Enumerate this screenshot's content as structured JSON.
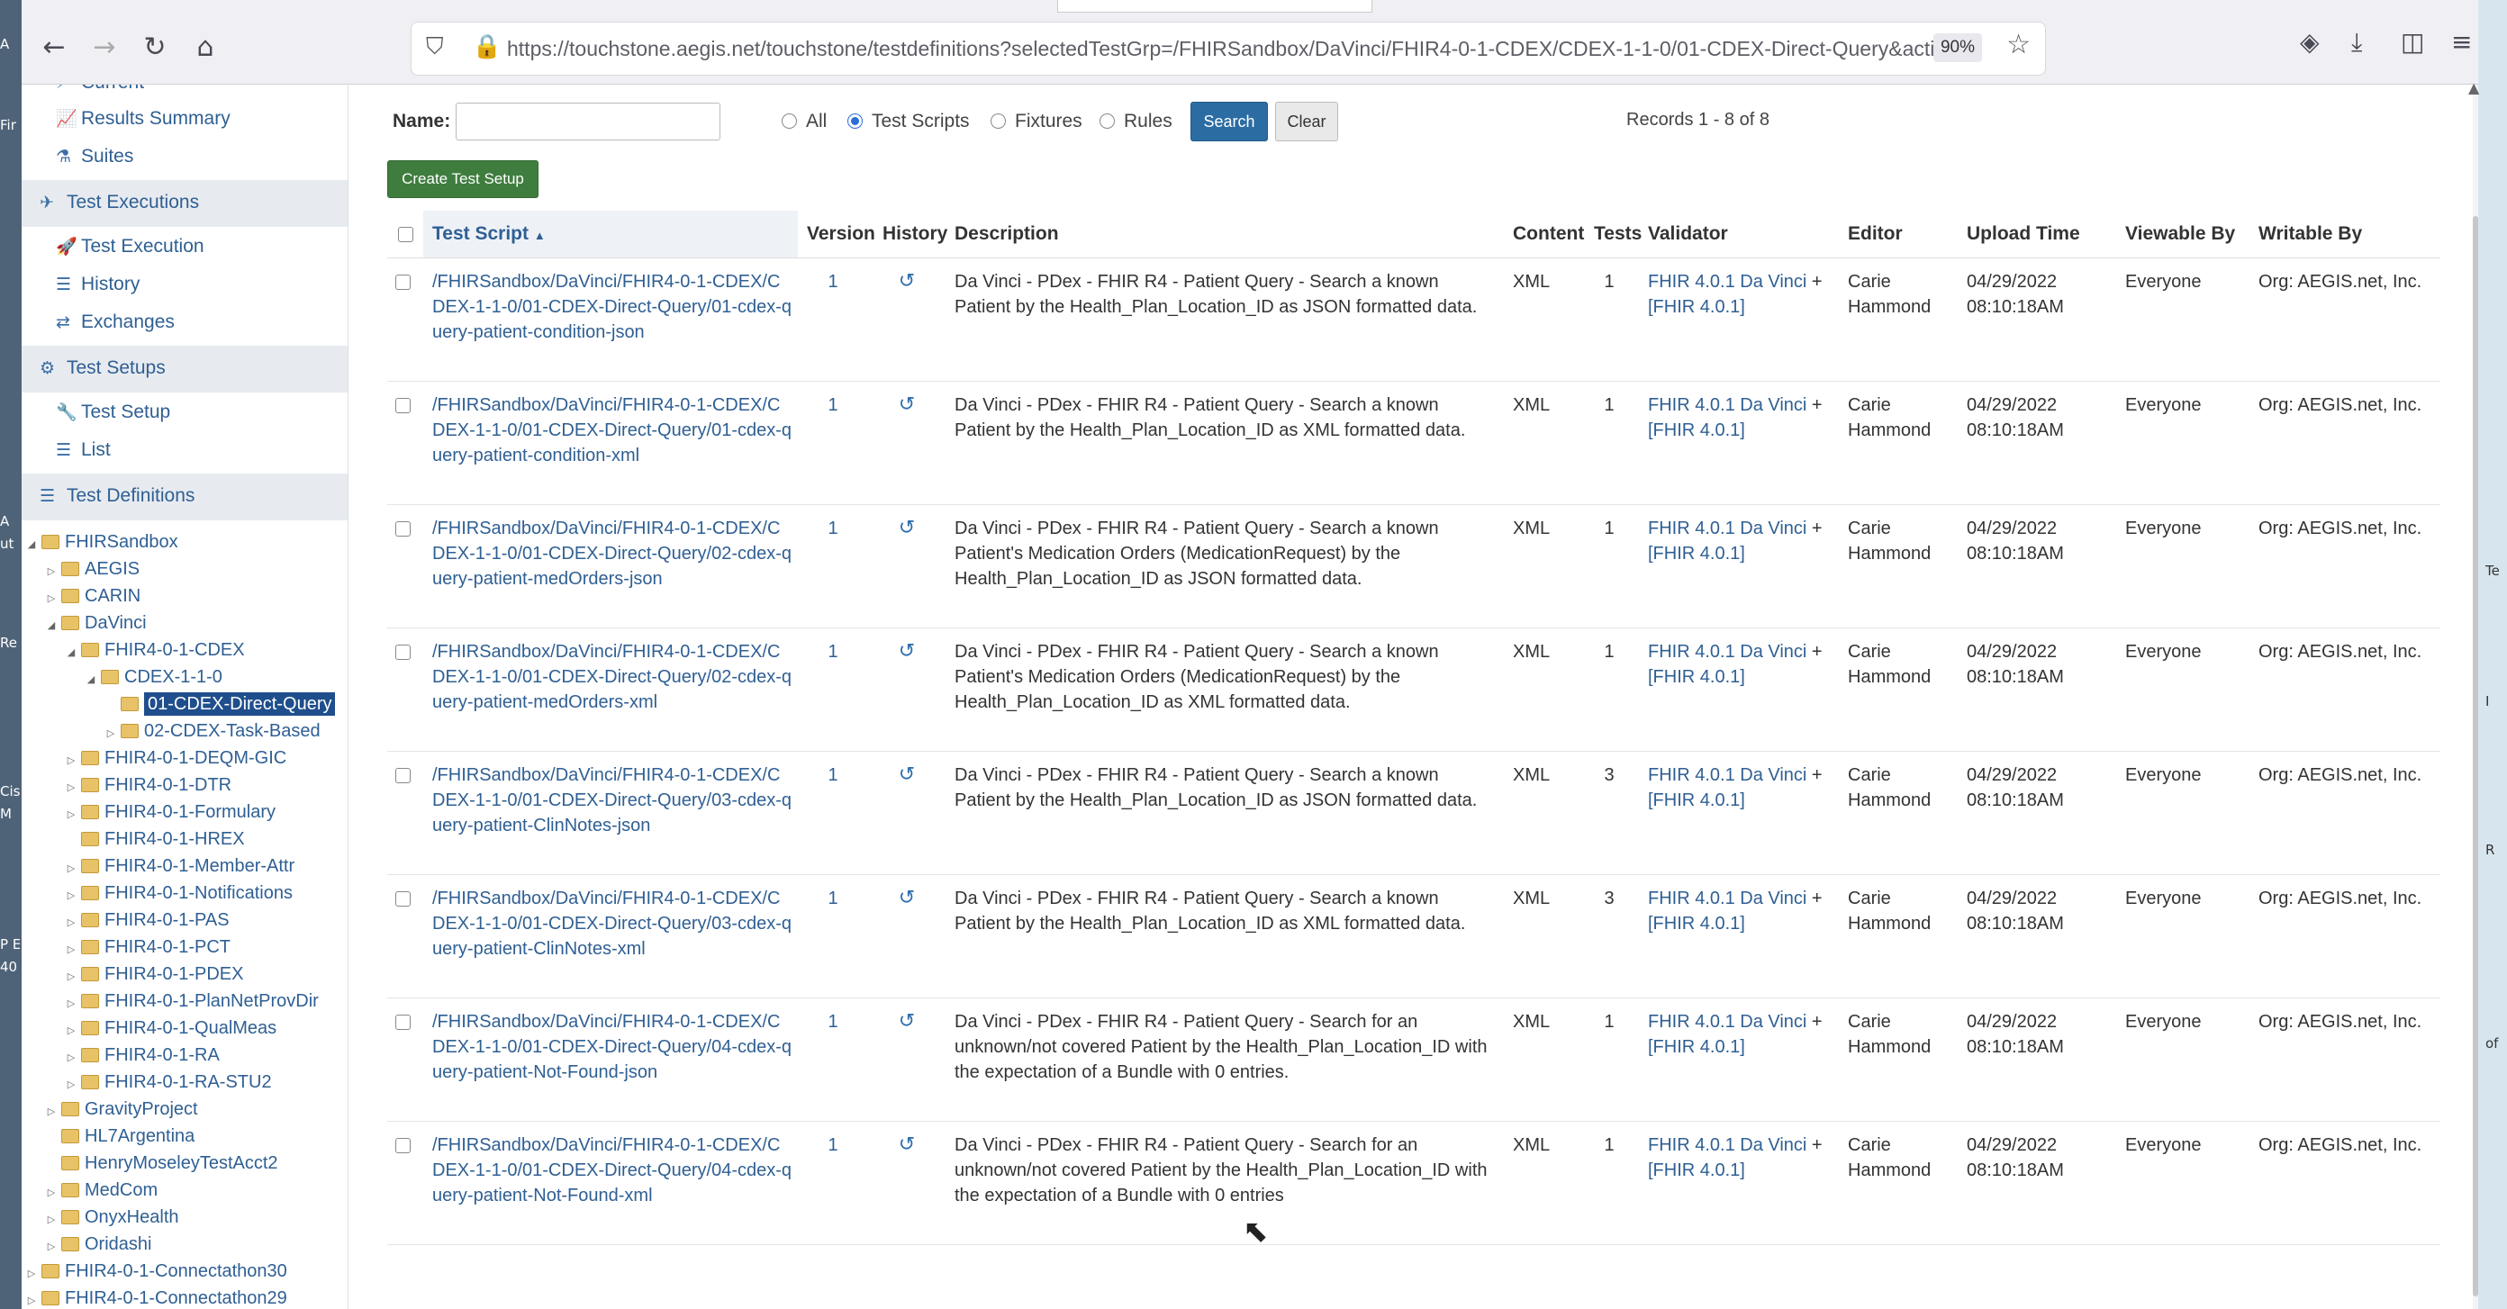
{
  "browser": {
    "url": "https://touchstone.aegis.net/touchstone/testdefinitions?selectedTestGrp=/FHIRSandbox/DaVinci/FHIR4-0-1-CDEX/CDEX-1-1-0/01-CDEX-Direct-Query&activeOnly=true&cont",
    "zoom": "90%",
    "back_icon": "←",
    "forward_icon": "→",
    "reload_icon": "↻",
    "home_icon": "⌂",
    "security_icons": "⛉ 🔒",
    "bookmark_star_icon": "☆",
    "pocket_icon": "◈",
    "download_icon": "⤓",
    "sidebar_icon": "◫",
    "menu_icon": "≡"
  },
  "desktop_left_fragments": [
    "A",
    "Fir",
    "A",
    "ut",
    "Re",
    "Cis",
    "M",
    "P E",
    "40"
  ],
  "desktop_right_fragments": [
    "Te",
    "I",
    "R",
    "of"
  ],
  "sidebar": {
    "current": "Current",
    "results_summary": "Results Summary",
    "suites": "Suites",
    "test_executions": "Test Executions",
    "test_execution": "Test Execution",
    "history": "History",
    "exchanges": "Exchanges",
    "test_setups": "Test Setups",
    "test_setup": "Test Setup",
    "list": "List",
    "test_definitions": "Test Definitions",
    "icons": {
      "current": "⚡",
      "results_summary": "📈",
      "suites": "⚗",
      "test_executions": "✈",
      "test_execution": "🚀",
      "history": "☰",
      "exchanges": "⇄",
      "test_setups": "⚙",
      "test_setup": "🔧",
      "list": "☰",
      "test_definitions": "☰"
    },
    "tree": [
      "FHIRSandbox",
      "AEGIS",
      "CARIN",
      "DaVinci",
      "FHIR4-0-1-CDEX",
      "CDEX-1-1-0",
      "01-CDEX-Direct-Query",
      "02-CDEX-Task-Based",
      "FHIR4-0-1-DEQM-GIC",
      "FHIR4-0-1-DTR",
      "FHIR4-0-1-Formulary",
      "FHIR4-0-1-HREX",
      "FHIR4-0-1-Member-Attr",
      "FHIR4-0-1-Notifications",
      "FHIR4-0-1-PAS",
      "FHIR4-0-1-PCT",
      "FHIR4-0-1-PDEX",
      "FHIR4-0-1-PlanNetProvDir",
      "FHIR4-0-1-QualMeas",
      "FHIR4-0-1-RA",
      "FHIR4-0-1-RA-STU2",
      "GravityProject",
      "HL7Argentina",
      "HenryMoseleyTestAcct2",
      "MedCom",
      "OnyxHealth",
      "Oridashi",
      "FHIR4-0-1-Connectathon30",
      "FHIR4-0-1-Connectathon29"
    ],
    "tree_toggle_expanded": "◢",
    "tree_toggle_collapsed": "▷"
  },
  "filter": {
    "name_label": "Name:",
    "name_value": "",
    "radio_all": "All",
    "radio_test_scripts": "Test Scripts",
    "radio_fixtures": "Fixtures",
    "radio_rules": "Rules",
    "selected": "Test Scripts",
    "search_label": "Search",
    "clear_label": "Clear",
    "records": "Records 1 - 8 of 8",
    "create_label": "Create Test Setup"
  },
  "table": {
    "headers": {
      "test_script": "Test Script",
      "sort_icon": "▲",
      "version": "Version",
      "history": "History",
      "description": "Description",
      "content": "Content",
      "tests": "Tests",
      "validator": "Validator",
      "editor": "Editor",
      "upload_time": "Upload Time",
      "viewable_by": "Viewable By",
      "writable_by": "Writable By"
    },
    "history_icon": "↺",
    "rows": [
      {
        "script": "/FHIRSandbox/DaVinci/FHIR4-0-1-CDEX/CDEX-1-1-0/01-CDEX-Direct-Query/01-cdex-query-patient-condition-json",
        "version": "1",
        "description": "Da Vinci - PDex - FHIR R4 - Patient Query - Search a known Patient by the Health_Plan_Location_ID as JSON formatted data.",
        "content": "XML",
        "tests": "1",
        "validator_link1": "FHIR 4.0.1 Da Vinci",
        "validator_plus": " + ",
        "validator_link2": "[FHIR 4.0.1]",
        "editor": "Carie Hammond",
        "upload_time": "04/29/2022 08:10:18AM",
        "viewable_by": "Everyone",
        "writable_by": "Org: AEGIS.net, Inc."
      },
      {
        "script": "/FHIRSandbox/DaVinci/FHIR4-0-1-CDEX/CDEX-1-1-0/01-CDEX-Direct-Query/01-cdex-query-patient-condition-xml",
        "version": "1",
        "description": "Da Vinci - PDex - FHIR R4 - Patient Query - Search a known Patient by the Health_Plan_Location_ID as XML formatted data.",
        "content": "XML",
        "tests": "1",
        "validator_link1": "FHIR 4.0.1 Da Vinci",
        "validator_plus": " + ",
        "validator_link2": "[FHIR 4.0.1]",
        "editor": "Carie Hammond",
        "upload_time": "04/29/2022 08:10:18AM",
        "viewable_by": "Everyone",
        "writable_by": "Org: AEGIS.net, Inc."
      },
      {
        "script": "/FHIRSandbox/DaVinci/FHIR4-0-1-CDEX/CDEX-1-1-0/01-CDEX-Direct-Query/02-cdex-query-patient-medOrders-json",
        "version": "1",
        "description": "Da Vinci - PDex - FHIR R4 - Patient Query - Search a known Patient's Medication Orders (MedicationRequest) by the Health_Plan_Location_ID as JSON formatted data.",
        "content": "XML",
        "tests": "1",
        "validator_link1": "FHIR 4.0.1 Da Vinci",
        "validator_plus": " + ",
        "validator_link2": "[FHIR 4.0.1]",
        "editor": "Carie Hammond",
        "upload_time": "04/29/2022 08:10:18AM",
        "viewable_by": "Everyone",
        "writable_by": "Org: AEGIS.net, Inc."
      },
      {
        "script": "/FHIRSandbox/DaVinci/FHIR4-0-1-CDEX/CDEX-1-1-0/01-CDEX-Direct-Query/02-cdex-query-patient-medOrders-xml",
        "version": "1",
        "description": "Da Vinci - PDex - FHIR R4 - Patient Query - Search a known Patient's Medication Orders (MedicationRequest) by the Health_Plan_Location_ID as XML formatted data.",
        "content": "XML",
        "tests": "1",
        "validator_link1": "FHIR 4.0.1 Da Vinci",
        "validator_plus": " + ",
        "validator_link2": "[FHIR 4.0.1]",
        "editor": "Carie Hammond",
        "upload_time": "04/29/2022 08:10:18AM",
        "viewable_by": "Everyone",
        "writable_by": "Org: AEGIS.net, Inc."
      },
      {
        "script": "/FHIRSandbox/DaVinci/FHIR4-0-1-CDEX/CDEX-1-1-0/01-CDEX-Direct-Query/03-cdex-query-patient-ClinNotes-json",
        "version": "1",
        "description": "Da Vinci - PDex - FHIR R4 - Patient Query - Search a known Patient by the Health_Plan_Location_ID as JSON formatted data.",
        "content": "XML",
        "tests": "3",
        "validator_link1": "FHIR 4.0.1 Da Vinci",
        "validator_plus": " + ",
        "validator_link2": "[FHIR 4.0.1]",
        "editor": "Carie Hammond",
        "upload_time": "04/29/2022 08:10:18AM",
        "viewable_by": "Everyone",
        "writable_by": "Org: AEGIS.net, Inc."
      },
      {
        "script": "/FHIRSandbox/DaVinci/FHIR4-0-1-CDEX/CDEX-1-1-0/01-CDEX-Direct-Query/03-cdex-query-patient-ClinNotes-xml",
        "version": "1",
        "description": "Da Vinci - PDex - FHIR R4 - Patient Query - Search a known Patient by the Health_Plan_Location_ID as XML formatted data.",
        "content": "XML",
        "tests": "3",
        "validator_link1": "FHIR 4.0.1 Da Vinci",
        "validator_plus": " + ",
        "validator_link2": "[FHIR 4.0.1]",
        "editor": "Carie Hammond",
        "upload_time": "04/29/2022 08:10:18AM",
        "viewable_by": "Everyone",
        "writable_by": "Org: AEGIS.net, Inc."
      },
      {
        "script": "/FHIRSandbox/DaVinci/FHIR4-0-1-CDEX/CDEX-1-1-0/01-CDEX-Direct-Query/04-cdex-query-patient-Not-Found-json",
        "version": "1",
        "description": "Da Vinci - PDex - FHIR R4 - Patient Query - Search for an unknown/not covered Patient by the Health_Plan_Location_ID with the expectation of a Bundle with 0 entries.",
        "content": "XML",
        "tests": "1",
        "validator_link1": "FHIR 4.0.1 Da Vinci",
        "validator_plus": " + ",
        "validator_link2": "[FHIR 4.0.1]",
        "editor": "Carie Hammond",
        "upload_time": "04/29/2022 08:10:18AM",
        "viewable_by": "Everyone",
        "writable_by": "Org: AEGIS.net, Inc."
      },
      {
        "script": "/FHIRSandbox/DaVinci/FHIR4-0-1-CDEX/CDEX-1-1-0/01-CDEX-Direct-Query/04-cdex-query-patient-Not-Found-xml",
        "version": "1",
        "description": "Da Vinci - PDex - FHIR R4 - Patient Query - Search for an unknown/not covered Patient by the Health_Plan_Location_ID with the expectation of a Bundle with 0 entries",
        "content": "XML",
        "tests": "1",
        "validator_link1": "FHIR 4.0.1 Da Vinci",
        "validator_plus": " + ",
        "validator_link2": "[FHIR 4.0.1]",
        "editor": "Carie Hammond",
        "upload_time": "04/29/2022 08:10:18AM",
        "viewable_by": "Everyone",
        "writable_by": "Org: AEGIS.net, Inc."
      }
    ]
  },
  "cursor_icon": "⬉"
}
